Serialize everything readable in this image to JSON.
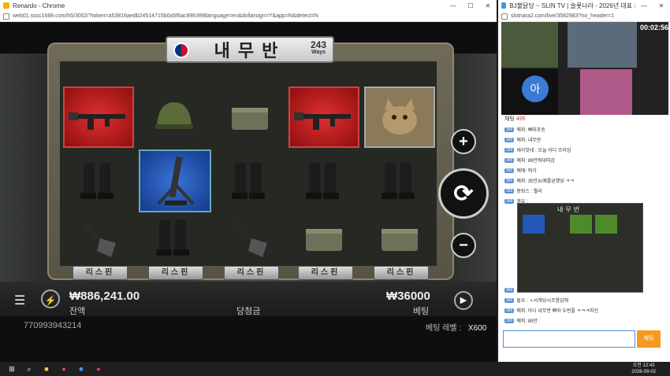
{
  "left_window": {
    "title": "Renardo - Chrome",
    "url": "web01.sssc1688.com/h5/3002/?token=a53816aedb24514715b0a5f6ac89fc998language=en&dollarsign=Y&app=N&detect=N"
  },
  "right_window": {
    "title": "BJ불닭당 ~ SLIN TV | 슬롯나라 - 2026년 대표 카지노사이...",
    "url": "slotnara2.com/live/3582983?no_header=1",
    "timer": "00:02:56",
    "chat_count_label": "채팅",
    "chat_count": "495",
    "send_label": "채팅",
    "messages": [
      {
        "badge": "365",
        "text": "예피: 빠따포등"
      },
      {
        "badge": "365",
        "text": "예피: 내무반"
      },
      {
        "badge": "365",
        "text": "제리맛네 : 오늘 어디 조러임"
      },
      {
        "badge": "365",
        "text": "예피: 89만줘대띠갑"
      },
      {
        "badge": "365",
        "text": "예에: 뭐가"
      },
      {
        "badge": "365",
        "text": "예피: 35만3c예를굳했당 ㅋㅋ"
      },
      {
        "badge": "365",
        "text": "몽퇴스 : 뭘리"
      },
      {
        "badge": "365",
        "text": "영유 :"
      }
    ],
    "messages2": [
      {
        "badge": "365",
        "text": "이맨야 : ㅠㅠ커버다"
      },
      {
        "badge": "365",
        "text": "돌요 : ㅅ서계당시조함임에"
      },
      {
        "badge": "365",
        "text": "예피: 아니 내무반 빠따 두번플 ㅋㅋㅋ띠진"
      },
      {
        "badge": "365",
        "text": "예피: 89만 :"
      }
    ]
  },
  "game": {
    "title": "내무반",
    "ways": "243",
    "ways_label": "Ways",
    "respin_label": "리스핀",
    "balance": "₩886,241.00",
    "balance_label": "잔액",
    "win_label": "당첨금",
    "bet": "₩36000",
    "bet_label": "베팅",
    "session_id": "770993943214",
    "bet_level_label": "베팅 레벨 :",
    "bet_level": "X600"
  },
  "taskbar": {
    "time": "오전 12:43",
    "date": "2026-09-02"
  },
  "colors": {
    "red_cell": "#c0201f",
    "blue_cell": "#1f4fb0",
    "send_button": "#f59a1e"
  }
}
